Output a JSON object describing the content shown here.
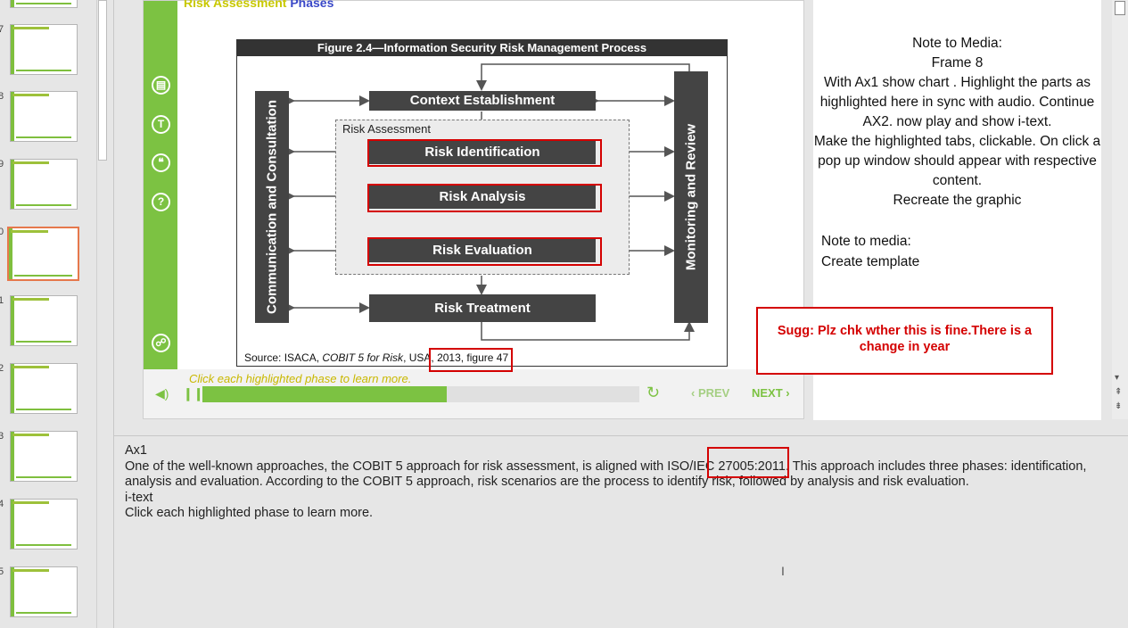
{
  "thumbnails": [
    {
      "num": "7"
    },
    {
      "num": "8"
    },
    {
      "num": "9"
    },
    {
      "num": "0",
      "selected": true
    },
    {
      "num": "1"
    },
    {
      "num": "2"
    },
    {
      "num": "3"
    },
    {
      "num": "4"
    },
    {
      "num": "5"
    }
  ],
  "slide": {
    "title_part1": "Risk Assessment",
    "title_part2": "Phases",
    "side_icons": [
      "notes-icon",
      "glossary-icon",
      "quote-icon",
      "help-icon",
      "chat-icon"
    ],
    "side_icon_glyphs": [
      "▤",
      "T",
      "❝",
      "?",
      "☍"
    ],
    "figure": {
      "heading": "Figure 2.4—Information Security Risk Management Process",
      "left_vertical": "Communication and Consultation",
      "right_vertical": "Monitoring and Review",
      "context": "Context Establishment",
      "group_label": "Risk Assessment",
      "identification": "Risk Identification",
      "analysis": "Risk Analysis",
      "evaluation": "Risk Evaluation",
      "treatment": "Risk Treatment",
      "source_prefix": "Source:  ISACA, ",
      "source_title": "COBIT 5 for Risk",
      "source_suffix": ", USA, 2013, figure 47"
    },
    "controls": {
      "instruction": "Click each highlighted phase to learn more.",
      "prev": "‹ PREV",
      "next": "NEXT ›",
      "progress": 0.56
    }
  },
  "note_panel": {
    "center_lines": [
      "Note to Media:",
      "Frame  8",
      "With Ax1 show chart . Highlight the parts as highlighted here in sync with audio. Continue AX2. now play and show i-text.",
      "Make the highlighted tabs, clickable. On click a pop up window should appear with respective content.",
      "Recreate the graphic"
    ],
    "left_lines": [
      "Note to media:",
      "Create template"
    ],
    "suggestion": "Sugg: Plz chk wther this is fine.There is a change in year"
  },
  "notes": {
    "label": "Ax1",
    "body": "One of the well-known approaches, the COBIT 5 approach for risk assessment, is aligned with ISO/IEC 27005:2011. This approach includes three phases: identification, analysis and evaluation. According to the COBIT 5 approach, risk scenarios are the process to identify risk, followed by analysis and risk evaluation.",
    "itext_label": "i-text",
    "itext": "Click each highlighted phase to learn more."
  }
}
